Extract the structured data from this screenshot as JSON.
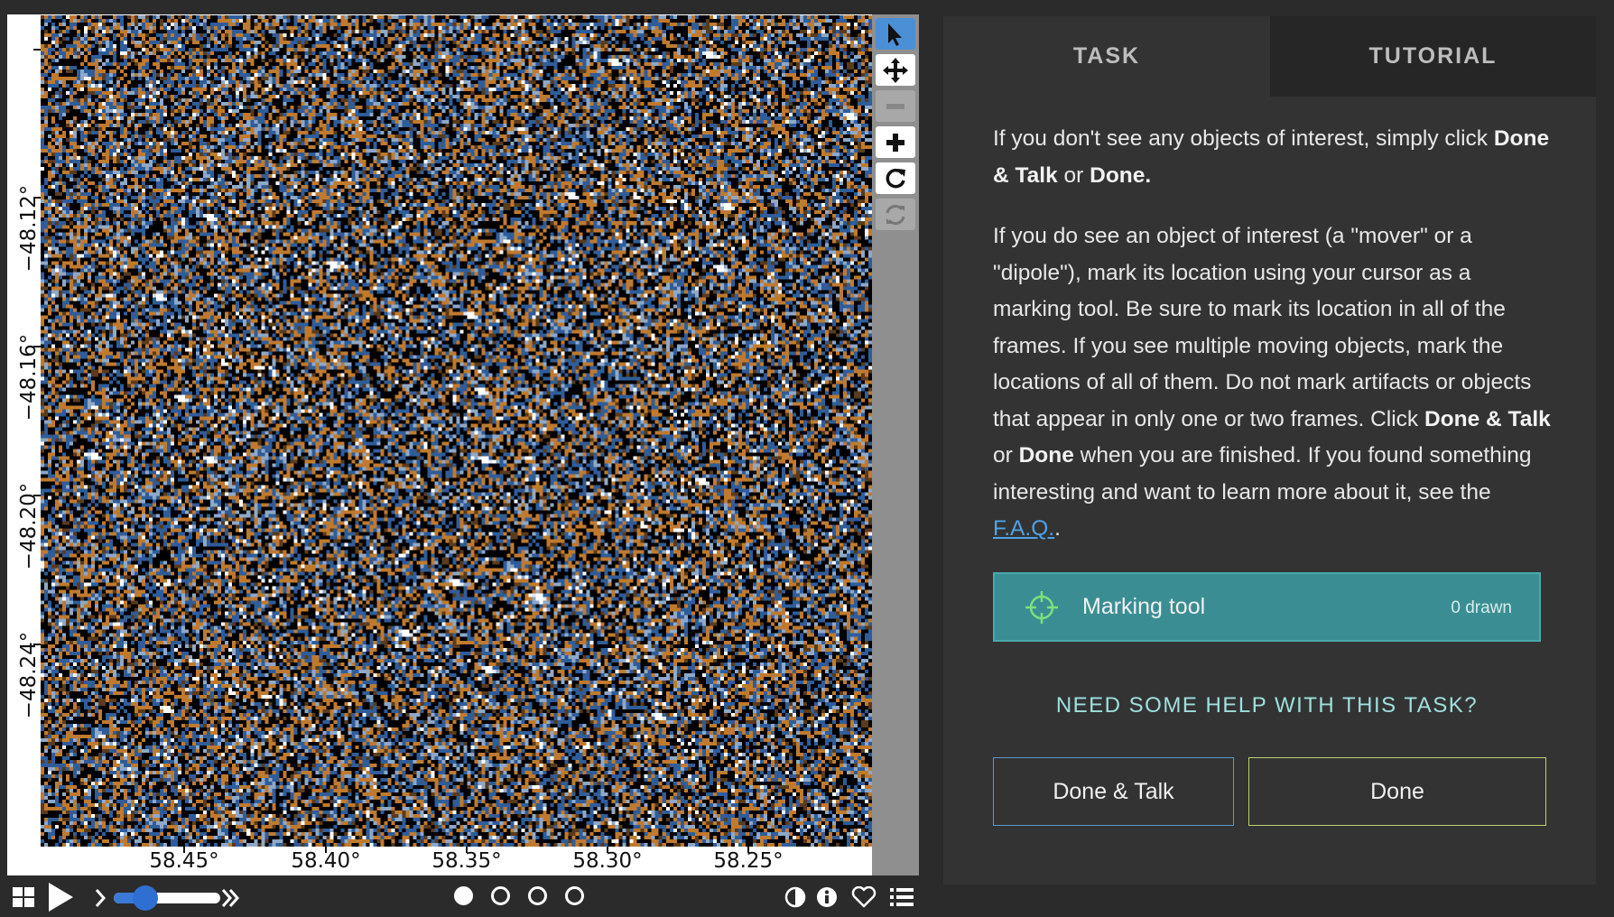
{
  "viewer": {
    "y_axis": {
      "ticks": [
        "−48.12°",
        "−48.16°",
        "−48.20°",
        "−48.24°"
      ]
    },
    "x_axis": {
      "ticks": [
        "58.45°",
        "58.40°",
        "58.35°",
        "58.30°",
        "58.25°"
      ]
    },
    "noise_colors": [
      "#000000",
      "#c07a2e",
      "#2f5d9a",
      "#8ea8c8",
      "#5a3b1c",
      "#ffffff"
    ],
    "toolbar": [
      "pointer-icon",
      "move-icon",
      "zoom-out-icon",
      "zoom-in-icon",
      "rotate-icon",
      "reset-icon"
    ]
  },
  "controls": {
    "icons": [
      "grid-icon",
      "play-icon",
      "step-forward-icon",
      "fast-forward-icon",
      "contrast-icon",
      "info-icon",
      "heart-icon",
      "list-icon"
    ],
    "playback_speed_fraction": 0.3,
    "frames": 4,
    "current_frame": 1
  },
  "panel": {
    "tabs": {
      "task": "TASK",
      "tutorial": "TUTORIAL"
    },
    "p1": {
      "text_a": "If you don't see any objects of interest, simply click ",
      "bold_a": "Done & Talk",
      "text_b": " or ",
      "bold_b": "Done."
    },
    "p2": {
      "text_a": "If you do see an object of interest (a \"mover\" or a \"dipole\"), mark its location using your cursor as a marking tool. Be sure to mark its location in all of the frames. If you see multiple moving objects, mark the locations of all of them. Do not mark artifacts or objects that appear in only one or two frames. Click ",
      "bold_a": "Done & Talk",
      "text_b": " or ",
      "bold_b": "Done",
      "text_c": " when you are finished. If you found something interesting and want to learn more about it, see the ",
      "link": "F.A.Q.",
      "text_d": "."
    },
    "marking_tool": {
      "label": "Marking tool",
      "count": "0 drawn",
      "icon": "crosshair-icon",
      "color": "#3a8e93"
    },
    "help": "NEED SOME HELP WITH THIS TASK?",
    "buttons": {
      "done_talk": "Done & Talk",
      "done": "Done"
    }
  }
}
